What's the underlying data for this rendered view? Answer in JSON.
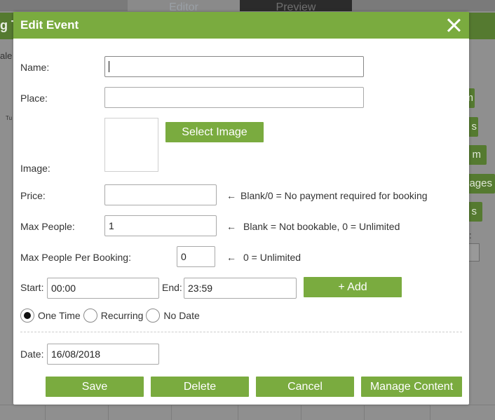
{
  "background": {
    "tabs": [
      "Editor",
      "Preview"
    ],
    "header_fragment": "g T",
    "left_fragment": "ale",
    "left_tiny": "Tu",
    "right_buttons": [
      "m",
      "s",
      "m",
      "ages",
      "s"
    ],
    "right_label": ":"
  },
  "modal": {
    "title": "Edit Event",
    "fields": {
      "name": {
        "label": "Name:",
        "value": ""
      },
      "place": {
        "label": "Place:",
        "value": ""
      },
      "image": {
        "label": "Image:",
        "button": "Select Image"
      },
      "price": {
        "label": "Price:",
        "value": "",
        "hint": "Blank/0 = No payment required for booking"
      },
      "max_people": {
        "label": "Max People:",
        "value": "1",
        "hint": "Blank = Not bookable, 0 = Unlimited"
      },
      "max_per_booking": {
        "label": "Max People Per Booking:",
        "value": "0",
        "hint": "0 = Unlimited"
      },
      "start": {
        "label": "Start:",
        "value": "00:00"
      },
      "end": {
        "label": "End:",
        "value": "23:59"
      },
      "add_button": "+ Add",
      "date": {
        "label": "Date:",
        "value": "16/08/2018"
      }
    },
    "arrow_glyph": "←",
    "recurrence": {
      "options": [
        "One Time",
        "Recurring",
        "No Date"
      ],
      "selected": "One Time"
    },
    "actions": {
      "save": "Save",
      "delete": "Delete",
      "cancel": "Cancel",
      "manage_content": "Manage Content"
    }
  },
  "colors": {
    "accent": "#7aab3f",
    "overlay_header": "#557a30"
  }
}
